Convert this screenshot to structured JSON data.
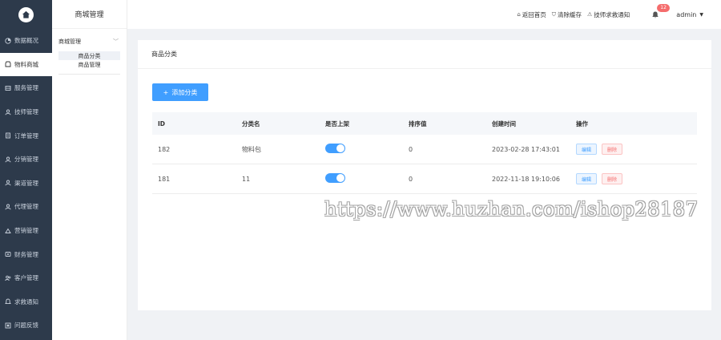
{
  "sidebar": {
    "items": [
      {
        "icon": "pie-chart-icon",
        "label": "数据概况"
      },
      {
        "icon": "shop-icon",
        "label": "物料商城",
        "active": true
      },
      {
        "icon": "service-icon",
        "label": "服务管理"
      },
      {
        "icon": "technician-icon",
        "label": "技师管理"
      },
      {
        "icon": "order-icon",
        "label": "订单管理"
      },
      {
        "icon": "distribution-icon",
        "label": "分销管理"
      },
      {
        "icon": "channel-icon",
        "label": "渠道管理"
      },
      {
        "icon": "agent-icon",
        "label": "代理管理"
      },
      {
        "icon": "marketing-icon",
        "label": "营销管理"
      },
      {
        "icon": "finance-icon",
        "label": "财务管理"
      },
      {
        "icon": "customer-icon",
        "label": "客户管理"
      },
      {
        "icon": "bell-icon",
        "label": "求救通知"
      },
      {
        "icon": "feedback-icon",
        "label": "问题反馈"
      }
    ]
  },
  "submenu": {
    "title": "商城管理",
    "group": "商城管理",
    "items": [
      {
        "label": "商品分类",
        "active": true
      },
      {
        "label": "商品管理"
      }
    ]
  },
  "topbar": {
    "home_link": "返回首页",
    "clear_cache": "清除缓存",
    "tech_notice": "技师求救通知",
    "notification_count": "12",
    "user": "admin"
  },
  "card": {
    "title": "商品分类",
    "add_button": "添加分类"
  },
  "table": {
    "headers": [
      "ID",
      "分类名",
      "是否上架",
      "排序值",
      "创建时间",
      "操作"
    ],
    "rows": [
      {
        "id": "182",
        "name": "物料包",
        "on_shelf": true,
        "sort": "0",
        "created": "2023-02-28 17:43:01",
        "edit": "编辑",
        "delete": "删除"
      },
      {
        "id": "181",
        "name": "11",
        "on_shelf": true,
        "sort": "0",
        "created": "2022-11-18 19:10:06",
        "edit": "编辑",
        "delete": "删除"
      }
    ]
  },
  "watermark": "https://www.huzhan.com/ishop28187",
  "colors": {
    "sidebar_bg": "#2d3a4b",
    "primary": "#409eff",
    "danger": "#f56c6c"
  }
}
